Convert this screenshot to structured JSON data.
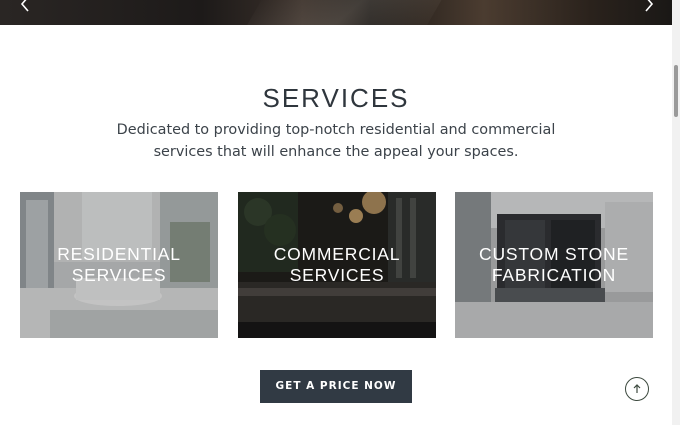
{
  "hero": {
    "prev_icon": "chevron-left-icon",
    "next_icon": "chevron-right-icon"
  },
  "services": {
    "title": "SERVICES",
    "description": "Dedicated to providing top-notch residential and commercial services that will enhance the appeal your spaces.",
    "cards": [
      {
        "label_line1": "RESIDENTIAL",
        "label_line2": "SERVICES"
      },
      {
        "label_line1": "COMMERCIAL",
        "label_line2": "SERVICES"
      },
      {
        "label_line1": "CUSTOM STONE",
        "label_line2": "FABRICATION"
      }
    ],
    "cta_label": "GET A PRICE NOW"
  },
  "back_to_top": {
    "icon": "arrow-up-icon"
  },
  "colors": {
    "cta_bg": "#313a44",
    "title_text": "#2f363d",
    "back_to_top_border": "#3d4a3f"
  }
}
